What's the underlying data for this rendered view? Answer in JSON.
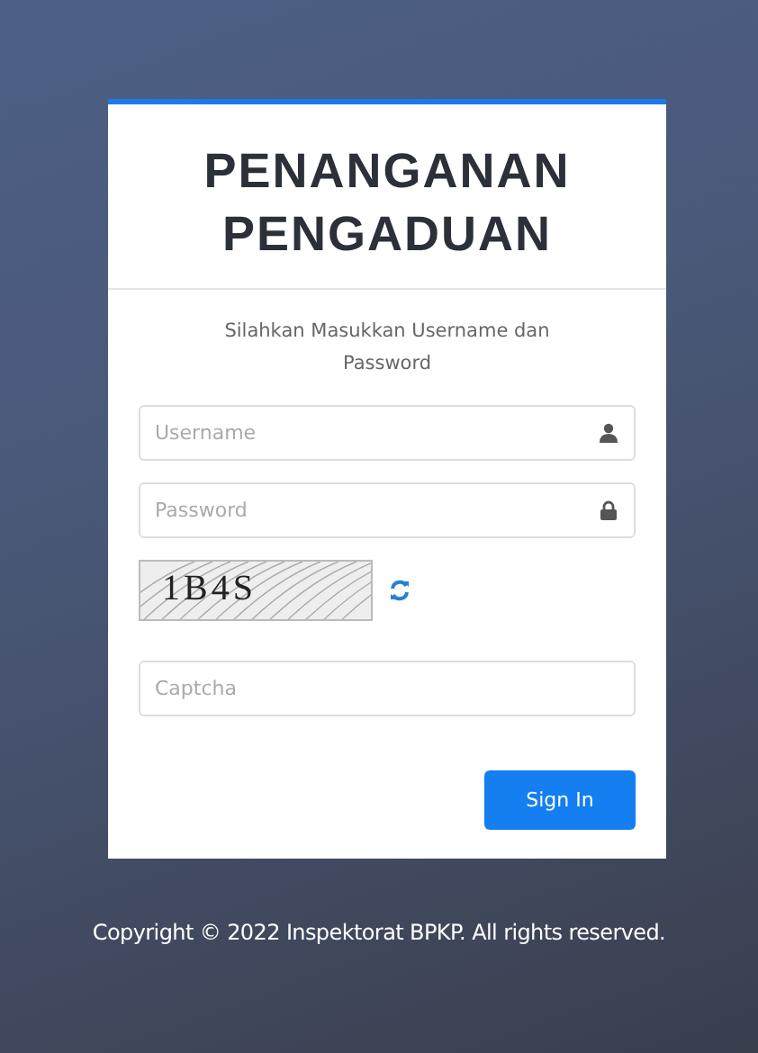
{
  "card": {
    "title": "PENANGANAN PENGADUAN",
    "subtitle": "Silahkan Masukkan Username dan Password"
  },
  "fields": [
    {
      "kind": "username",
      "placeholder": "Username"
    },
    {
      "kind": "password",
      "placeholder": "Password"
    }
  ],
  "captcha": {
    "image_text": "1B4S",
    "placeholder": "Captcha"
  },
  "sign_in_button": "Sign In",
  "footer": "Copyright © 2022 Inspektorat BPKP. All rights reserved."
}
